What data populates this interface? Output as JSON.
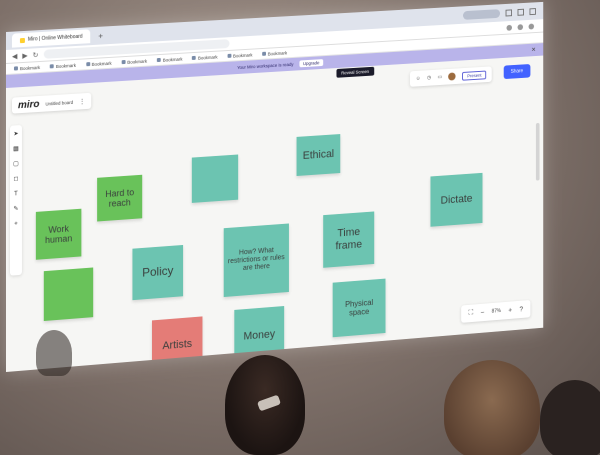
{
  "browser": {
    "tab_label": "Miro | Online Whiteboard",
    "new_tab": "+",
    "bookmarks": [
      "Bookmark",
      "Bookmark",
      "Bookmark",
      "Bookmark",
      "Bookmark",
      "Bookmark",
      "Bookmark",
      "Bookmark"
    ]
  },
  "banner": {
    "text": "Your Miro workspace is ready",
    "link": "Upgrade"
  },
  "tooltip": "Reveal Screen",
  "board": {
    "logo": "miro",
    "name": "Untitled board",
    "menu": "⋮",
    "share_label": "Share",
    "present_label": "Present",
    "zoom_percent": "87%",
    "zoom_minus": "−",
    "zoom_plus": "+",
    "help": "?"
  },
  "notes": [
    {
      "id": "work-human",
      "text": "Work human",
      "color": "green"
    },
    {
      "id": "hard-to-reach",
      "text": "Hard to reach",
      "color": "green"
    },
    {
      "id": "teal-small",
      "text": "",
      "color": "teal"
    },
    {
      "id": "ethical",
      "text": "Ethical",
      "color": "teal"
    },
    {
      "id": "dictate",
      "text": "Dictate",
      "color": "teal"
    },
    {
      "id": "green-bottom",
      "text": "",
      "color": "green"
    },
    {
      "id": "policy",
      "text": "Policy",
      "color": "teal"
    },
    {
      "id": "how-what",
      "text": "How? What restrictions or rules are there",
      "color": "teal"
    },
    {
      "id": "time-frame",
      "text": "Time frame",
      "color": "teal"
    },
    {
      "id": "artists",
      "text": "Artists",
      "color": "pink"
    },
    {
      "id": "money",
      "text": "Money",
      "color": "teal"
    },
    {
      "id": "physical-space",
      "text": "Physical space",
      "color": "teal"
    }
  ]
}
